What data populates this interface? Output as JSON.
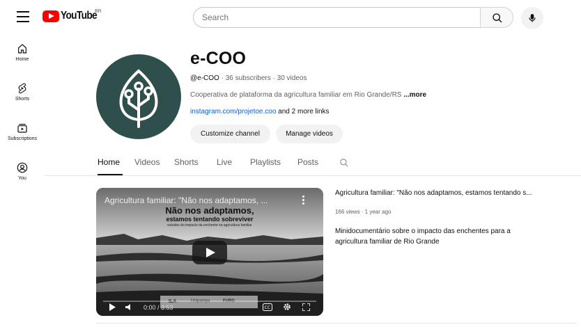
{
  "topbar": {
    "logo_text": "YouTube",
    "logo_country": "BR",
    "search_placeholder": "Search"
  },
  "sidebar": {
    "items": [
      {
        "label": "Home",
        "icon": "home-icon"
      },
      {
        "label": "Shorts",
        "icon": "shorts-icon"
      },
      {
        "label": "Subscriptions",
        "icon": "subscriptions-icon"
      },
      {
        "label": "You",
        "icon": "you-icon"
      }
    ]
  },
  "channel": {
    "name": "e-COO",
    "handle": "@e-COO",
    "stats": " · 36 subscribers · 30 videos",
    "description": "Cooperativa de plataforma da agricultura familiar em Rio Grande/RS ",
    "more_label": "...more",
    "link_text": "instagram.com/projetoe.coo",
    "more_links": " and 2 more links",
    "customize_label": "Customize channel",
    "manage_label": "Manage videos"
  },
  "tabs": [
    {
      "label": "Home",
      "active": true
    },
    {
      "label": "Videos",
      "active": false
    },
    {
      "label": "Shorts",
      "active": false
    },
    {
      "label": "Live",
      "active": false
    },
    {
      "label": "Playlists",
      "active": false
    },
    {
      "label": "Posts",
      "active": false
    }
  ],
  "video": {
    "player_title": "Agricultura familiar: \"Não nos adaptamos, ...",
    "overlay_line1": "Não nos adaptamos,",
    "overlay_line2": "estamos tentando sobreviver",
    "overlay_line3": "estudos do impacto da enchente na agricultura familiar",
    "time": "0:00 / 3:53",
    "sponsor_logos": [
      "ILA",
      "Unipampa",
      "FURG"
    ],
    "title": "Agricultura familiar: \"Não nos adaptamos, estamos tentando s...",
    "meta": "166 views · 1 year ago",
    "description": "Minidocumentário sobre o impacto das enchentes para a agricultura familiar de Rio Grande"
  },
  "colors": {
    "brand_red": "#ff0000",
    "avatar_bg": "#2f4f4c",
    "link_blue": "#065fd4"
  }
}
